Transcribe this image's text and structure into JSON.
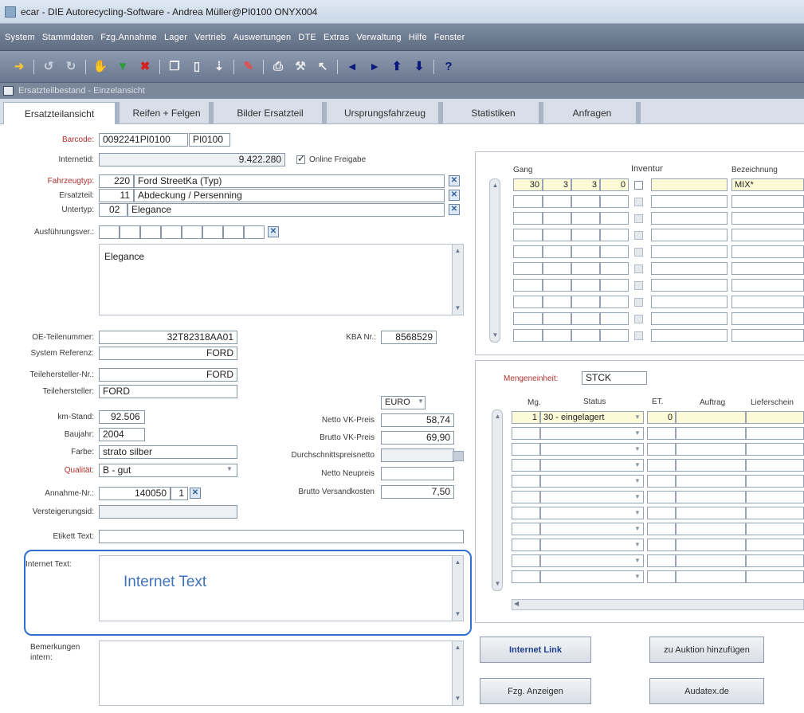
{
  "window": {
    "title": "ecar - DIE Autorecycling-Software - Andrea Müller@PI0100   ONYX004"
  },
  "menu": [
    "System",
    "Stammdaten",
    "Fzg.Annahme",
    "Lager",
    "Vertrieb",
    "Auswertungen",
    "DTE",
    "Extras",
    "Verwaltung",
    "Hilfe",
    "Fenster"
  ],
  "toolbar": {
    "icons": [
      "exit-icon",
      "undo-icon",
      "redo-icon",
      "hand-icon",
      "filter-icon",
      "delete-icon",
      "copy-icon",
      "page-icon",
      "sort-icon",
      "pen-icon",
      "print-icon",
      "tools-icon",
      "pointer-icon",
      "prev-icon",
      "next-icon",
      "up-icon",
      "down-icon",
      "help-icon"
    ],
    "help": "?"
  },
  "subwindow": {
    "title": "Ersatzteilbestand - Einzelansicht"
  },
  "tabs": [
    "Ersatzteilansicht",
    "Reifen + Felgen",
    "Bilder Ersatzteil",
    "Ursprungsfahrzeug",
    "Statistiken",
    "Anfragen"
  ],
  "form": {
    "barcode_label": "Barcode:",
    "barcode_1": "0092241PI0100",
    "barcode_2": "PI0100",
    "internetid_label": "Internetid:",
    "internetid": "9.422.280",
    "online_label": "Online Freigabe",
    "fahrzeugtyp_label": "Fahrzeugtyp:",
    "fahrzeugtyp_code": "220",
    "fahrzeugtyp": "Ford StreetKa  (Typ)",
    "ersatzteil_label": "Ersatzteil:",
    "ersatzteil_code": "11",
    "ersatzteil": "Abdeckung / Persenning",
    "untertyp_label": "Untertyp:",
    "untertyp_code": "02",
    "untertyp": "Elegance",
    "ausfuehrung_label": "Ausführungsver.:",
    "beschreibung": "Elegance",
    "oe_label": "OE-Teilenummer:",
    "oe": "32T82318AA01",
    "kba_label": "KBA Nr.:",
    "kba": "8568529",
    "sysref_label": "System Referenz:",
    "sysref": "FORD",
    "teilhnr_label": "Teilehersteller-Nr.:",
    "teilhnr": "FORD",
    "teilh_label": "Teilehersteller:",
    "teilh": "FORD",
    "km_label": "km-Stand:",
    "km": "92.506",
    "baujahr_label": "Baujahr:",
    "baujahr": "2004",
    "farbe_label": "Farbe:",
    "farbe": "strato silber",
    "qualitaet_label": "Qualität:",
    "qualitaet": "B - gut",
    "annahme_label": "Annahme-Nr.:",
    "annahme": "140050",
    "annahme_pos": "1",
    "versteig_label": "Versteigerungsid:",
    "etikett_label": "Etikett Text:",
    "internettext_label": "Internet Text:",
    "internettext": "Internet Text",
    "bemerk_label": "Bemerkungen intern:",
    "currency": "EURO",
    "netto_vk_label": "Netto VK-Preis",
    "netto_vk": "58,74",
    "brutto_vk_label": "Brutto VK-Preis",
    "brutto_vk": "69,90",
    "durchschnitt_label": "Durchschnittspreisnetto",
    "netto_neu_label": "Netto Neupreis",
    "versand_label": "Brutto Versandkosten",
    "versand": "7,50"
  },
  "lager": {
    "headers": {
      "gang": "Gang",
      "inventur": "Inventur",
      "bezeichnung": "Bezeichnung"
    },
    "row1": {
      "gang": "30",
      "a": "3",
      "b": "3",
      "c": "0",
      "bez": "MIX*"
    }
  },
  "bestand": {
    "mengen_label": "Mengeneinheit:",
    "mengen": "STCK",
    "headers": {
      "mg": "Mg.",
      "status": "Status",
      "et": "ET.",
      "auftrag": "Auftrag",
      "liefer": "Lieferschein"
    },
    "row1": {
      "mg": "1",
      "status": "30 - eingelagert",
      "et": "0"
    }
  },
  "buttons": {
    "internet_link": "Internet Link",
    "auktion": "zu Auktion hinzufügen",
    "fzg": "Fzg. Anzeigen",
    "audatex": "Audatex.de"
  }
}
